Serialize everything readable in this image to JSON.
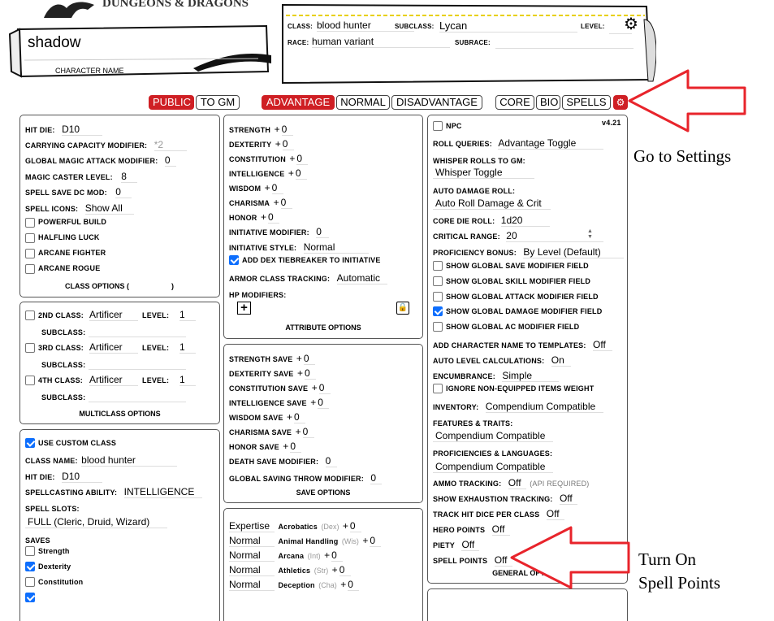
{
  "header": {
    "logo_text": "DUNGEONS & DRAGONS",
    "character_name": "shadow",
    "character_name_label": "CHARACTER NAME",
    "class_label": "CLASS:",
    "class_value": "blood hunter",
    "subclass_label": "SUBCLASS:",
    "subclass_value": "Lycan",
    "level_label": "LEVEL:",
    "race_label": "RACE:",
    "race_value": "human variant",
    "subrace_label": "SUBRACE:"
  },
  "toolbar": {
    "public": "PUBLIC",
    "to_gm": "TO GM",
    "advantage": "ADVANTAGE",
    "normal": "NORMAL",
    "disadvantage": "DISADVANTAGE",
    "core": "CORE",
    "bio": "BIO",
    "spells": "SPELLS"
  },
  "class_options": {
    "hit_die_label": "HIT DIE:",
    "hit_die": "D10",
    "carry_label": "CARRYING CAPACITY MODIFIER:",
    "carry": "*2",
    "gma_label": "GLOBAL MAGIC ATTACK MODIFIER:",
    "gma": "0",
    "mcl_label": "MAGIC CASTER LEVEL:",
    "mcl": "8",
    "ssdc_label": "SPELL SAVE DC MOD:",
    "ssdc": "0",
    "icons_label": "SPELL ICONS:",
    "icons": "Show All",
    "powerful_build": "POWERFUL BUILD",
    "halfling_luck": "HALFLING LUCK",
    "arcane_fighter": "ARCANE FIGHTER",
    "arcane_rogue": "ARCANE ROGUE",
    "caption_left": "CLASS OPTIONS (",
    "caption_right": ")"
  },
  "multiclass": {
    "c2_label": "2ND CLASS:",
    "c2": "Artificer",
    "c3_label": "3RD CLASS:",
    "c3": "Artificer",
    "c4_label": "4TH CLASS:",
    "c4": "Artificer",
    "level_label": "LEVEL:",
    "level": "1",
    "subclass_label": "SUBCLASS:",
    "caption": "MULTICLASS OPTIONS"
  },
  "custom_class": {
    "use_label": "USE CUSTOM CLASS",
    "name_label": "CLASS NAME:",
    "name": "blood hunter",
    "hit_die_label": "HIT DIE:",
    "hit_die": "D10",
    "ability_label": "SPELLCASTING ABILITY:",
    "ability": "INTELLIGENCE",
    "slots_label": "SPELL SLOTS:",
    "slots": "FULL (Cleric, Druid, Wizard)",
    "saves_label": "SAVES",
    "strength": "Strength",
    "dexterity": "Dexterity",
    "constitution": "Constitution"
  },
  "attributes": {
    "strength": "STRENGTH",
    "dexterity": "DEXTERITY",
    "constitution": "CONSTITUTION",
    "intelligence": "INTELLIGENCE",
    "wisdom": "WISDOM",
    "charisma": "CHARISMA",
    "honor": "HONOR",
    "plus": "+",
    "zero": "0",
    "init_mod_label": "INITIATIVE MODIFIER:",
    "init_mod": "0",
    "init_style_label": "INITIATIVE STYLE:",
    "init_style": "Normal",
    "dex_tiebreaker": "ADD DEX TIEBREAKER TO INITIATIVE",
    "armor_label": "ARMOR CLASS TRACKING:",
    "armor": "Automatic",
    "hp_label": "HP MODIFIERS:",
    "add": "+",
    "caption": "ATTRIBUTE OPTIONS"
  },
  "saves": {
    "strength": "STRENGTH SAVE",
    "dexterity": "DEXTERITY SAVE",
    "constitution": "CONSTITUTION SAVE",
    "intelligence": "INTELLIGENCE SAVE",
    "wisdom": "WISDOM SAVE",
    "charisma": "CHARISMA SAVE",
    "honor": "HONOR SAVE",
    "death_label": "DEATH SAVE MODIFIER:",
    "death": "0",
    "global_label": "GLOBAL SAVING THROW MODIFIER:",
    "global": "0",
    "caption": "SAVE OPTIONS"
  },
  "skills": [
    {
      "prof": "Expertise",
      "name": "Acrobatics",
      "abbr": "(Dex)",
      "mod": "0"
    },
    {
      "prof": "Normal",
      "name": "Animal Handling",
      "abbr": "(Wis)",
      "mod": "0"
    },
    {
      "prof": "Normal",
      "name": "Arcana",
      "abbr": "(Int)",
      "mod": "0"
    },
    {
      "prof": "Normal",
      "name": "Athletics",
      "abbr": "(Str)",
      "mod": "0"
    },
    {
      "prof": "Normal",
      "name": "Deception",
      "abbr": "(Cha)",
      "mod": "0"
    }
  ],
  "general": {
    "version": "v4.21",
    "npc": "NPC",
    "rq_label": "ROLL QUERIES:",
    "rq": "Advantage Toggle",
    "wr_label": "WHISPER ROLLS TO GM:",
    "wr": "Whisper Toggle",
    "adr_label": "AUTO DAMAGE ROLL:",
    "adr": "Auto Roll Damage & Crit",
    "core_label": "CORE DIE ROLL:",
    "core": "1d20",
    "crit_label": "CRITICAL RANGE:",
    "crit": "20",
    "prof_label": "PROFICIENCY BONUS:",
    "prof": "By Level (Default)",
    "g_save": "SHOW GLOBAL SAVE MODIFIER FIELD",
    "g_skill": "SHOW GLOBAL SKILL MODIFIER FIELD",
    "g_attack": "SHOW GLOBAL ATTACK MODIFIER FIELD",
    "g_damage": "SHOW GLOBAL DAMAGE MODIFIER FIELD",
    "g_ac": "SHOW GLOBAL AC MODIFIER FIELD",
    "name_tpl_label": "ADD CHARACTER NAME TO TEMPLATES:",
    "name_tpl": "Off",
    "alc_label": "AUTO LEVEL CALCULATIONS:",
    "alc": "On",
    "enc_label": "ENCUMBRANCE:",
    "enc": "Simple",
    "ignore_weight": "IGNORE NON-EQUIPPED ITEMS WEIGHT",
    "inv_label": "INVENTORY:",
    "inv": "Compendium Compatible",
    "ft_label": "FEATURES & TRAITS:",
    "ft": "Compendium Compatible",
    "pl_label": "PROFICIENCIES & LANGUAGES:",
    "pl": "Compendium Compatible",
    "ammo_label": "AMMO TRACKING:",
    "ammo": "Off",
    "ammo_note": "(API REQUIRED)",
    "exh_label": "SHOW EXHAUSTION TRACKING:",
    "exh": "Off",
    "hd_label": "TRACK HIT DICE PER CLASS",
    "hd": "Off",
    "hero_label": "HERO POINTS",
    "hero": "Off",
    "piety_label": "PIETY",
    "piety": "Off",
    "sp_label": "SPELL POINTS",
    "sp": "Off",
    "caption": "GENERAL OPTIONS"
  },
  "annotations": {
    "settings": "Go to Settings",
    "spell_points_1": "Turn On",
    "spell_points_2": "Spell Points"
  },
  "colors": {
    "accent_red": "#cf1f24",
    "check_blue": "#0d6efd",
    "arrow_red": "#e8242b"
  }
}
